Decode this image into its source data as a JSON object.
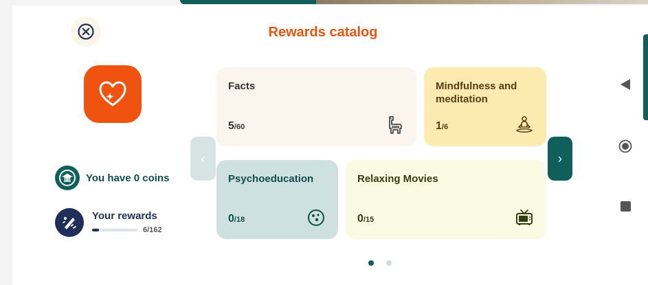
{
  "header": {
    "title": "Rewards catalog"
  },
  "icons": {
    "close": "close-circle-icon",
    "heart": "heart-sparkle-icon",
    "coins": "bank-coin-icon",
    "rewards": "rewards-badge-icon"
  },
  "sidebar": {
    "coins_text": "You have 0 coins",
    "rewards_label": "Your rewards",
    "rewards_count": "6/162",
    "rewards_progress": 0.037
  },
  "carousel": {
    "prev_label": "‹",
    "next_label": "›",
    "cards": [
      {
        "name": "Facts",
        "value": "5",
        "total": "/60",
        "icon": "llama-icon"
      },
      {
        "name": "Mindfulness and meditation",
        "value": "1",
        "total": "/6",
        "icon": "meditation-icon"
      },
      {
        "name": "Psychoeducation",
        "value": "0",
        "total": "/18",
        "icon": "brain-ball-icon"
      },
      {
        "name": "Relaxing Movies",
        "value": "0",
        "total": "/15",
        "icon": "tv-icon"
      }
    ],
    "pages": 2,
    "active_page": 1
  },
  "system_nav": {
    "back": "back-triangle-icon",
    "home": "home-circle-icon",
    "recent": "recent-square-icon"
  },
  "colors": {
    "accent": "#f0520f",
    "teal": "#0f5f5a",
    "navy": "#1f2f5a"
  }
}
